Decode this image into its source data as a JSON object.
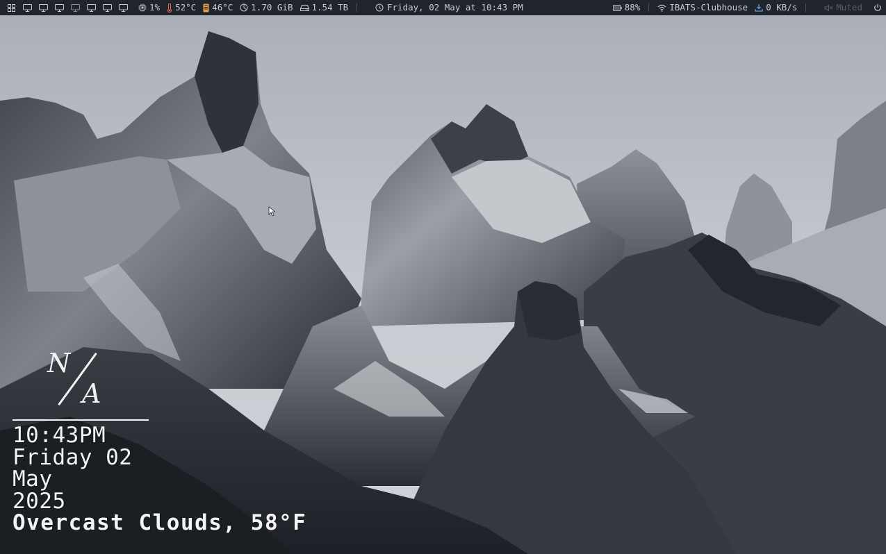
{
  "topbar": {
    "workspaces": [
      {
        "icon": "grid-icon",
        "active": true
      },
      {
        "icon": "monitor-icon"
      },
      {
        "icon": "monitor-icon"
      },
      {
        "icon": "monitor-icon"
      },
      {
        "icon": "monitor-icon"
      },
      {
        "icon": "monitor-icon"
      },
      {
        "icon": "monitor-icon"
      },
      {
        "icon": "monitor-icon"
      }
    ],
    "cpu": "1%",
    "cpu_temp": "52°C",
    "gpu_temp": "46°C",
    "memory": "1.70 GiB",
    "disk": "1.54 TB",
    "clock": "Friday, 02 May at 10:43 PM",
    "battery": "88%",
    "wifi_name": "IBATS-Clubhouse",
    "net_speed": "0 KB/s",
    "volume": "Muted",
    "colors": {
      "bar_bg": "#20242b",
      "text": "#c9ccd1",
      "download_accent": "#5aa0e6",
      "gpu_accent": "#e0a14a"
    }
  },
  "widget": {
    "logo_n": "N",
    "logo_a": "A",
    "time": "10:43PM",
    "day": "Friday 02",
    "month": "May",
    "year": "2025",
    "weather": "Overcast Clouds, 58°F"
  }
}
